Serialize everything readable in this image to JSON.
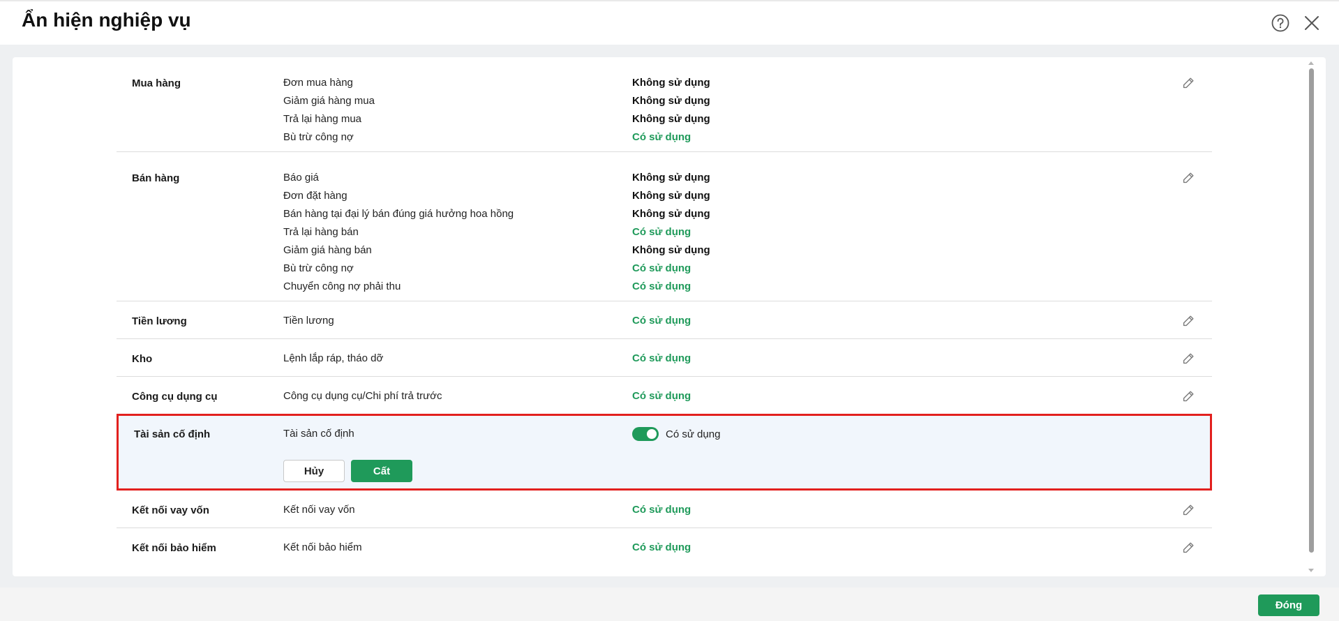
{
  "title": "Ẩn hiện nghiệp vụ",
  "footer": {
    "close_label": "Đóng"
  },
  "status_text": {
    "off": "Không sử dụng",
    "on": "Có sử dụng"
  },
  "colors": {
    "accent": "#1f9a5a",
    "highlight_border": "#e2201e"
  },
  "icons": {
    "help": "help-circle-icon",
    "close": "close-icon",
    "edit": "pencil-icon"
  },
  "groups": [
    {
      "name": "Mua hàng",
      "items": [
        {
          "label": "Đơn mua hàng",
          "status": "Không sử dụng",
          "enabled": false
        },
        {
          "label": "Giảm giá hàng mua",
          "status": "Không sử dụng",
          "enabled": false
        },
        {
          "label": "Trả lại hàng mua",
          "status": "Không sử dụng",
          "enabled": false
        },
        {
          "label": "Bù trừ công nợ",
          "status": "Có sử dụng",
          "enabled": true
        }
      ]
    },
    {
      "name": "Bán hàng",
      "items": [
        {
          "label": "Báo giá",
          "status": "Không sử dụng",
          "enabled": false
        },
        {
          "label": "Đơn đặt hàng",
          "status": "Không sử dụng",
          "enabled": false
        },
        {
          "label": "Bán hàng tại đại lý bán đúng giá hưởng hoa hồng",
          "status": "Không sử dụng",
          "enabled": false
        },
        {
          "label": "Trả lại hàng bán",
          "status": "Có sử dụng",
          "enabled": true
        },
        {
          "label": "Giảm giá hàng bán",
          "status": "Không sử dụng",
          "enabled": false
        },
        {
          "label": "Bù trừ công nợ",
          "status": "Có sử dụng",
          "enabled": true
        },
        {
          "label": "Chuyển công nợ phải thu",
          "status": "Có sử dụng",
          "enabled": true
        }
      ]
    },
    {
      "name": "Tiền lương",
      "items": [
        {
          "label": "Tiền lương",
          "status": "Có sử dụng",
          "enabled": true
        }
      ]
    },
    {
      "name": "Kho",
      "items": [
        {
          "label": "Lệnh lắp ráp, tháo dỡ",
          "status": "Có sử dụng",
          "enabled": true
        }
      ]
    },
    {
      "name": "Công cụ dụng cụ",
      "items": [
        {
          "label": "Công cụ dụng cụ/Chi phí trả trước",
          "status": "Có sử dụng",
          "enabled": true
        }
      ]
    }
  ],
  "editing_group": {
    "name": "Tài sản cố định",
    "item_label": "Tài sản cố định",
    "toggle_on": true,
    "toggle_label": "Có sử dụng",
    "cancel_label": "Hủy",
    "save_label": "Cất"
  },
  "groups_after": [
    {
      "name": "Kết nối vay vốn",
      "items": [
        {
          "label": "Kết nối vay vốn",
          "status": "Có sử dụng",
          "enabled": true
        }
      ]
    },
    {
      "name": "Kết nối bảo hiểm",
      "items": [
        {
          "label": "Kết nối bảo hiểm",
          "status": "Có sử dụng",
          "enabled": true
        }
      ]
    }
  ]
}
